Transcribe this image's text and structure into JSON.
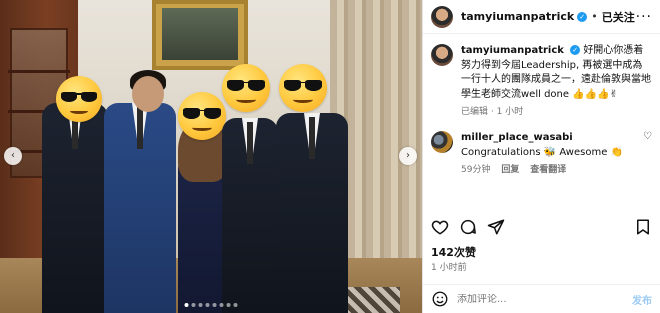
{
  "post": {
    "username": "tamyiumanpatrick",
    "follow_label": "已关注",
    "separator": "•",
    "more_glyph": "···"
  },
  "caption": {
    "username": "tamyiumanpatrick",
    "text": "好開心你憑着努力得到今屆Leadership, 再被選中成為一行十人的團隊成員之一，遠赴倫敦與當地學生老師交流well done 👍👍👍✌",
    "meta": "已编辑 · 1 小时"
  },
  "comments": [
    {
      "username": "miller_place_wasabi",
      "text": "Congratulations 🐝 Awesome 👏",
      "time": "59分钟",
      "reply_label": "回复",
      "translate_label": "查看翻译"
    }
  ],
  "stats": {
    "likes": "142次赞",
    "time_ago": "1 小时前"
  },
  "composer": {
    "placeholder": "添加评论...",
    "post_label": "发布"
  },
  "carousel": {
    "prev_glyph": "‹",
    "next_glyph": "›",
    "dot_count": 8,
    "active_dot": 0
  },
  "icons": {
    "verified": "verified-badge-icon",
    "like": "heart-icon",
    "comment": "comment-bubble-icon",
    "share": "paper-plane-icon",
    "save": "bookmark-icon",
    "emoji": "smiley-icon",
    "overlay": "sunglasses-emoji"
  },
  "colors": {
    "verified": "#1d9bf0",
    "meta": "#737373",
    "post_button": "#9ccaf5"
  }
}
